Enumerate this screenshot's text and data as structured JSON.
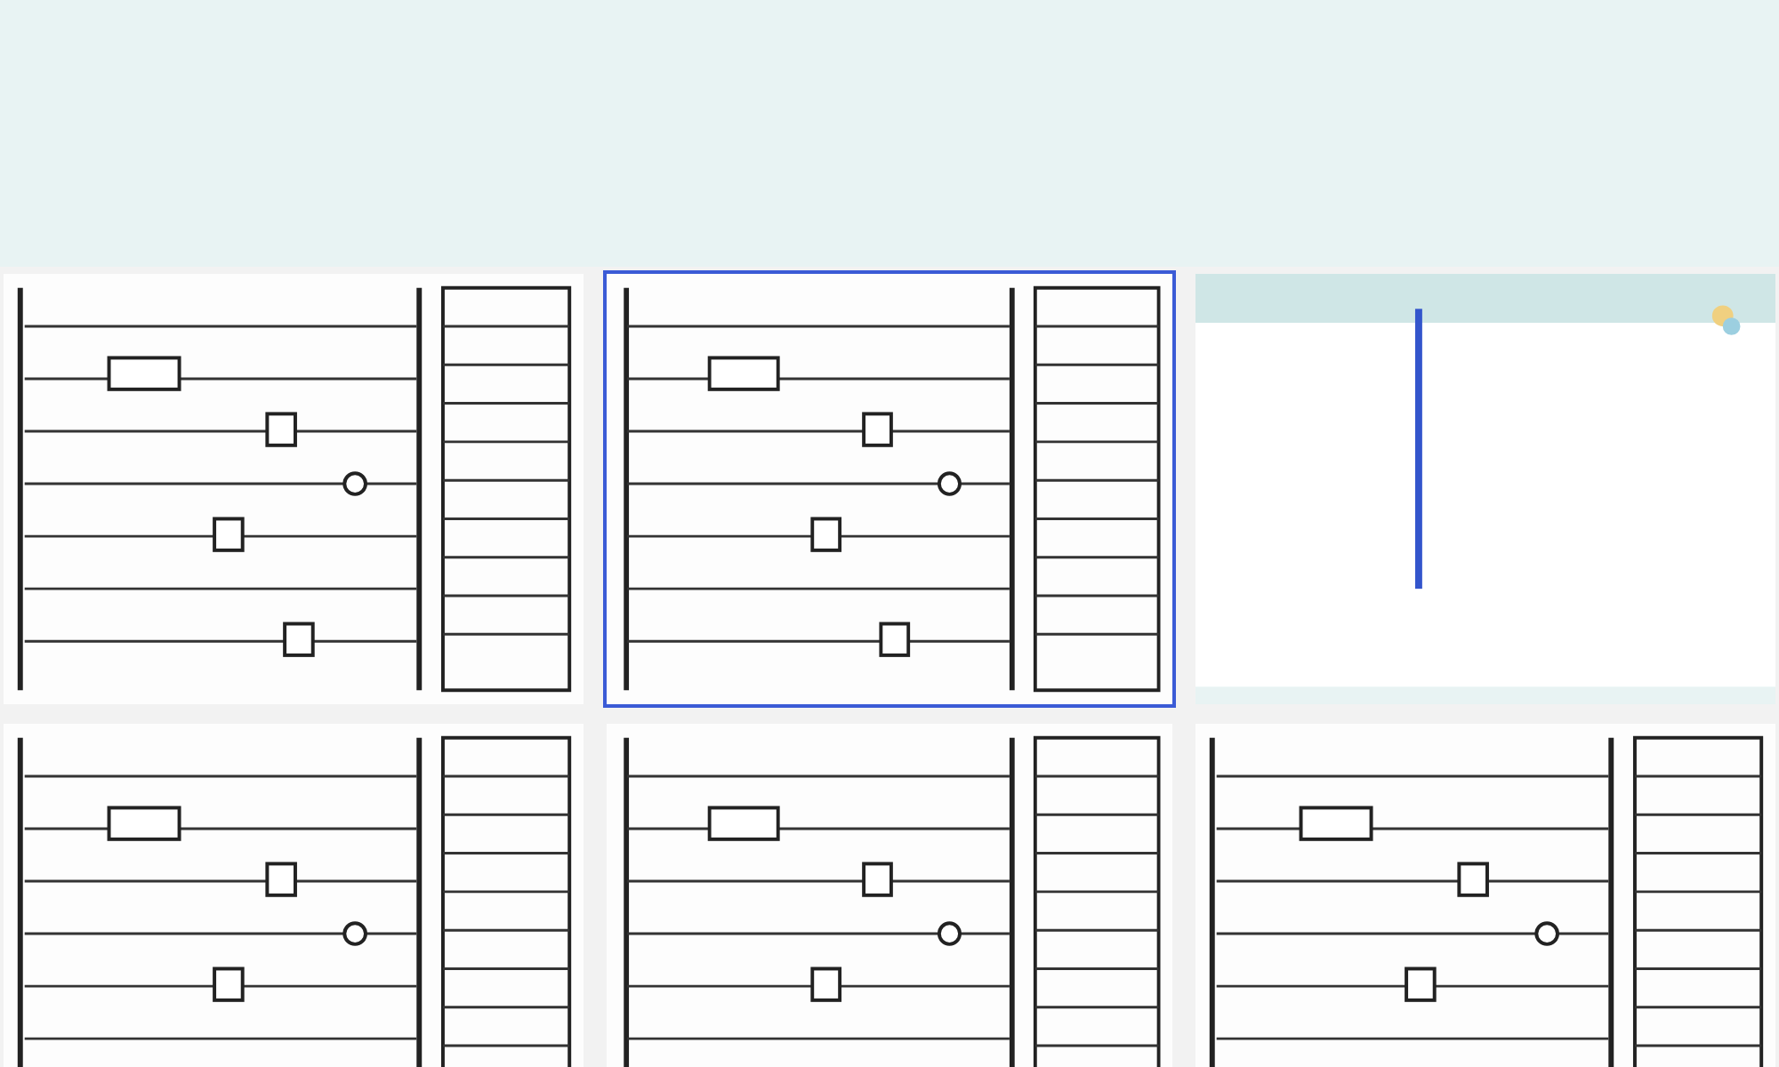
{
  "thumbnails": [
    {
      "kind": "picture",
      "selected": false
    },
    {
      "kind": "picture",
      "selected": true
    },
    {
      "kind": "picture",
      "selected": false
    },
    {
      "kind": "picture",
      "selected": false
    },
    {
      "kind": "picture",
      "selected": false
    },
    {
      "kind": "picture",
      "selected": false
    }
  ]
}
